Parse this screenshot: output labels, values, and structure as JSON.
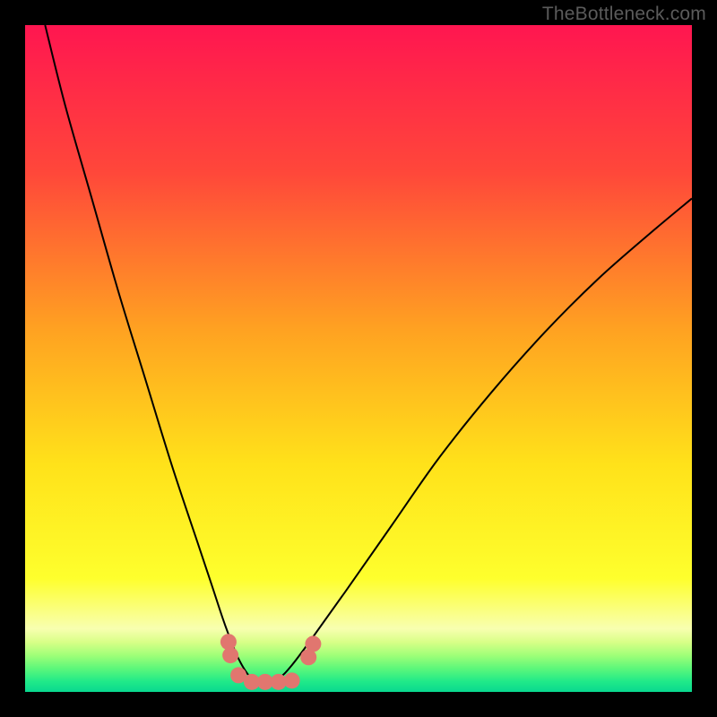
{
  "watermark": "TheBottleneck.com",
  "chart_data": {
    "type": "line",
    "title": "",
    "xlabel": "",
    "ylabel": "",
    "xlim": [
      0,
      100
    ],
    "ylim": [
      0,
      100
    ],
    "series": [
      {
        "name": "bottleneck-curve",
        "x": [
          3,
          6,
          10,
          14,
          18,
          22,
          26,
          28,
          30,
          32,
          34,
          36,
          38,
          40,
          43,
          48,
          55,
          62,
          70,
          78,
          86,
          94,
          100
        ],
        "y": [
          100,
          88,
          74,
          60,
          47,
          34,
          22,
          16,
          10,
          5,
          2,
          1.5,
          2,
          4,
          8,
          15,
          25,
          35,
          45,
          54,
          62,
          69,
          74
        ]
      }
    ],
    "markers": {
      "name": "dip-beads",
      "points": [
        {
          "x": 30.5,
          "y": 7.5
        },
        {
          "x": 30.8,
          "y": 5.5
        },
        {
          "x": 32.0,
          "y": 2.5
        },
        {
          "x": 34.0,
          "y": 1.5
        },
        {
          "x": 36.0,
          "y": 1.5
        },
        {
          "x": 38.0,
          "y": 1.5
        },
        {
          "x": 40.0,
          "y": 1.7
        },
        {
          "x": 42.5,
          "y": 5.2
        },
        {
          "x": 43.2,
          "y": 7.2
        }
      ]
    },
    "gradient_stops": [
      {
        "offset": 0.0,
        "color": "#ff1650"
      },
      {
        "offset": 0.22,
        "color": "#ff473a"
      },
      {
        "offset": 0.46,
        "color": "#ffa321"
      },
      {
        "offset": 0.66,
        "color": "#ffe21a"
      },
      {
        "offset": 0.83,
        "color": "#feff2d"
      },
      {
        "offset": 0.905,
        "color": "#f8ffb0"
      },
      {
        "offset": 0.925,
        "color": "#d9ff88"
      },
      {
        "offset": 0.945,
        "color": "#a0ff78"
      },
      {
        "offset": 0.965,
        "color": "#5cf77a"
      },
      {
        "offset": 0.985,
        "color": "#1fe989"
      },
      {
        "offset": 1.0,
        "color": "#09d88f"
      }
    ],
    "colors": {
      "curve": "#000000",
      "bead": "#e1766f",
      "frame": "#000000"
    }
  }
}
